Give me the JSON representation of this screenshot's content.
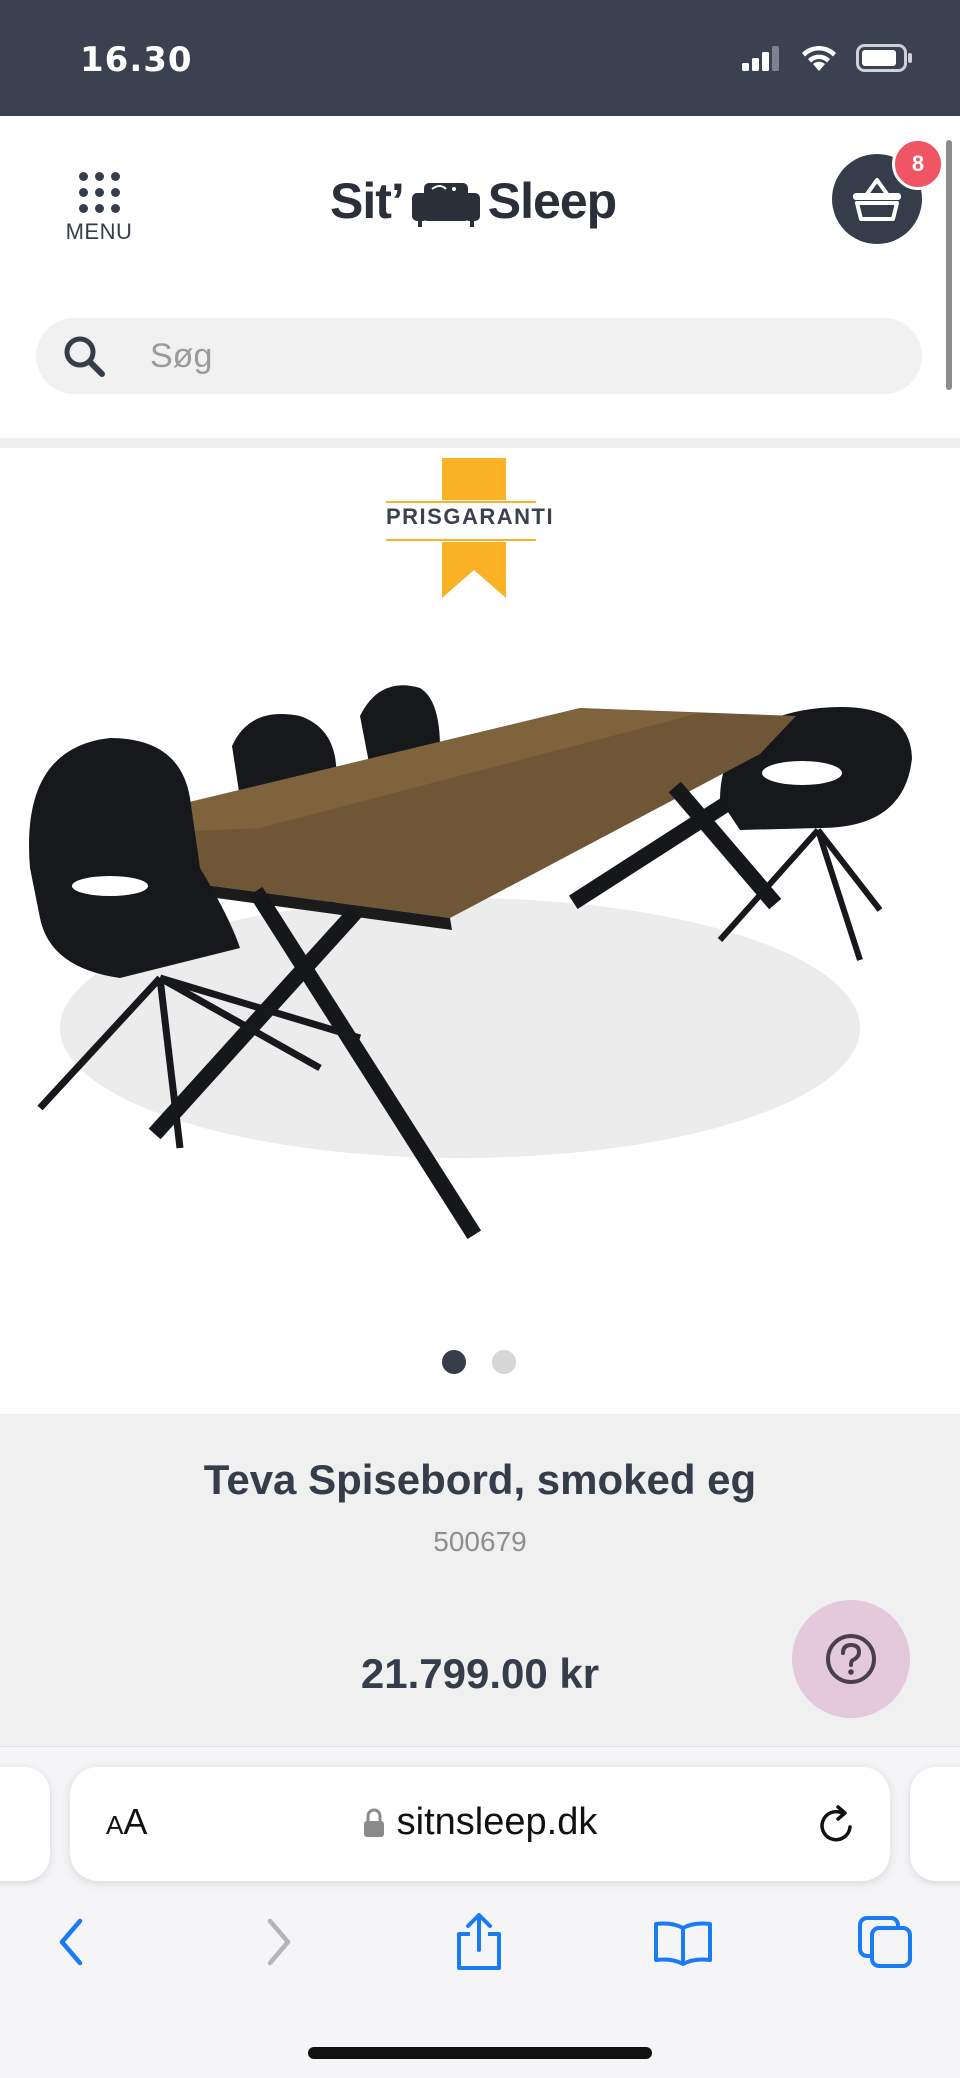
{
  "status_bar": {
    "time": "16.30"
  },
  "header": {
    "menu_label": "MENU",
    "logo_left": "Sit’",
    "logo_right": "Sleep",
    "cart_count": "8",
    "search_placeholder": "Søg"
  },
  "product": {
    "badge_text": "PRISGARANTI",
    "title": "Teva Spisebord, smoked eg",
    "sku": "500679",
    "price": "21.799.00 kr",
    "image_count": 2,
    "active_image": 1
  },
  "browser": {
    "aa_small": "A",
    "aa_large": "A",
    "url": "sitnsleep.dk"
  },
  "colors": {
    "status_bg": "#3a4150",
    "brand_dark": "#353c4a",
    "badge_red": "#ef5562",
    "badge_yellow": "#fbb124",
    "help_pink": "#e4c8dc",
    "ios_blue": "#1a7cf5"
  }
}
